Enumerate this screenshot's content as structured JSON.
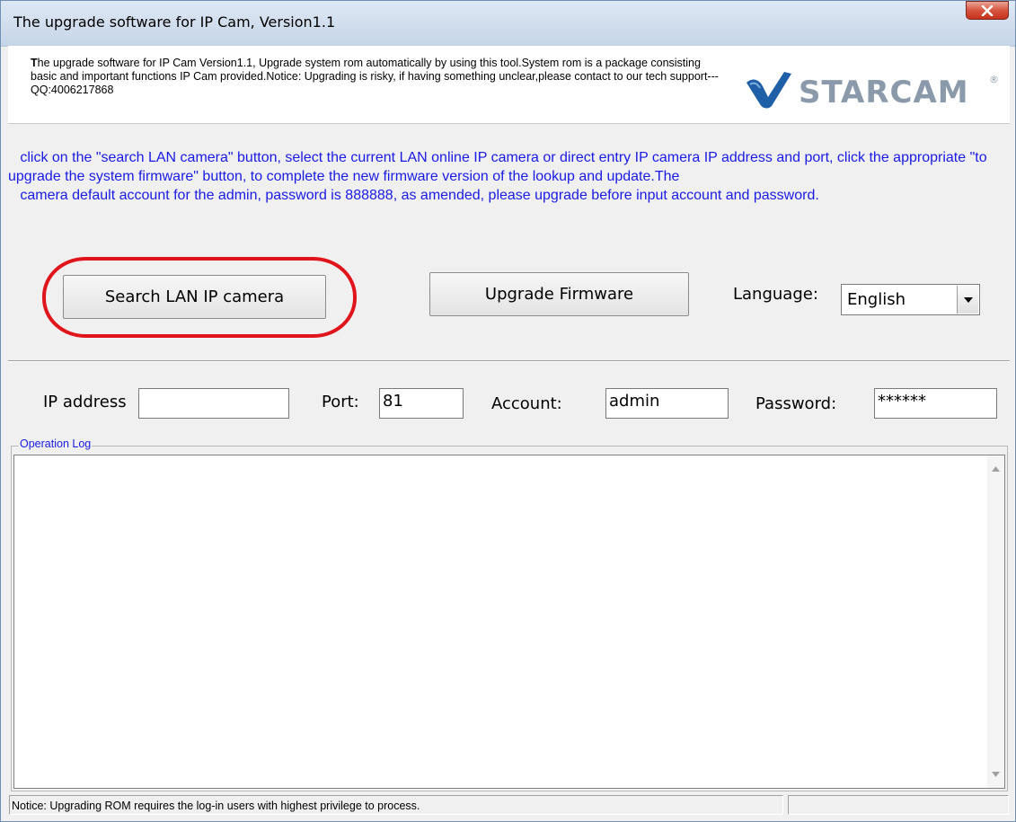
{
  "window": {
    "title": "The upgrade software for IP Cam, Version1.1"
  },
  "header": {
    "description_lead": "T",
    "description": "he upgrade software for IP Cam Version1.1, Upgrade system rom automatically by using this tool.System rom is a package consisting basic and important functions IP Cam provided.Notice: Upgrading is risky, if having something unclear,please contact to our tech support---QQ:4006217868",
    "logo_text": "STARCAM",
    "logo_registered": "®"
  },
  "instructions": {
    "paragraph1": "   click on the \"search LAN camera\" button, select the current LAN online IP camera or direct entry IP camera IP address and port, click the appropriate \"to upgrade the system firmware\" button, to complete the new firmware version of the lookup and update.The",
    "paragraph2": "   camera default account for the admin, password is 888888, as amended, please upgrade before input account and password."
  },
  "buttons": {
    "search_label": "Search LAN IP camera",
    "upgrade_label": "Upgrade Firmware"
  },
  "language": {
    "label": "Language:",
    "selected": "English"
  },
  "fields": {
    "ip_label": "IP address",
    "ip_value": "",
    "port_label": "Port:",
    "port_value": "81",
    "account_label": "Account:",
    "account_value": "admin",
    "password_label": "Password:",
    "password_value": "******"
  },
  "log": {
    "legend": "Operation Log"
  },
  "status": {
    "message": "Notice: Upgrading  ROM requires  the log-in users with highest privilege to process.",
    "secondary": ""
  },
  "colors": {
    "instruction_text": "#1a1ae6",
    "highlight_circle": "#e0141b",
    "logo_blue": "#1f5fa8",
    "logo_gray": "#8a9aab"
  }
}
